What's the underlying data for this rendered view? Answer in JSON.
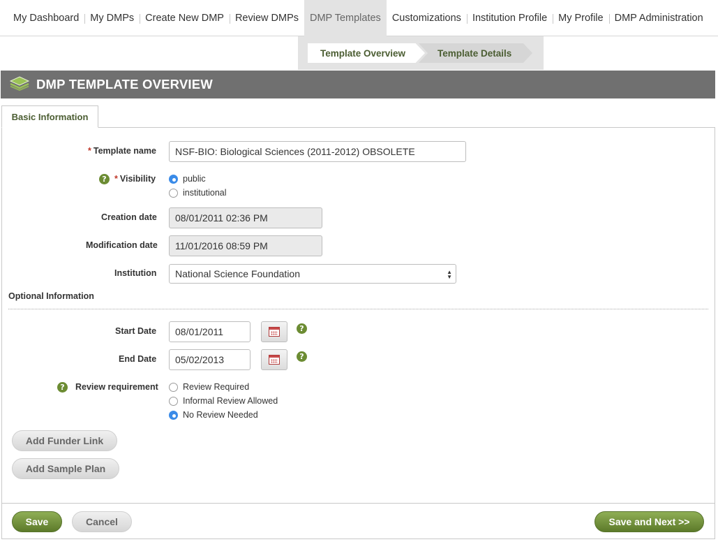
{
  "nav": {
    "items": [
      "My Dashboard",
      "My DMPs",
      "Create New DMP",
      "Review DMPs",
      "DMP Templates",
      "Customizations",
      "Institution Profile",
      "My Profile",
      "DMP Administration"
    ],
    "active": "DMP Templates"
  },
  "steps": [
    "Template Overview",
    "Template Details"
  ],
  "header": {
    "title": "DMP TEMPLATE OVERVIEW",
    "icon": "layers-icon"
  },
  "tab": "Basic Information",
  "form": {
    "template_name_label": "Template name",
    "template_name_value": "NSF-BIO: Biological Sciences (2011-2012) OBSOLETE",
    "visibility_label": "Visibility",
    "visibility_options": [
      "public",
      "institutional"
    ],
    "visibility_selected": "public",
    "creation_label": "Creation date",
    "creation_value": "08/01/2011 02:36 PM",
    "modification_label": "Modification date",
    "modification_value": "11/01/2016 08:59 PM",
    "institution_label": "Institution",
    "institution_value": "National Science Foundation",
    "required_mark": "*",
    "help_glyph": "?"
  },
  "optional": {
    "title": "Optional Information",
    "start_label": "Start Date",
    "start_value": "08/01/2011",
    "end_label": "End Date",
    "end_value": "05/02/2013",
    "review_label": "Review requirement",
    "review_options": [
      "Review Required",
      "Informal Review Allowed",
      "No Review Needed"
    ],
    "review_selected": "No Review Needed"
  },
  "buttons": {
    "add_funder": "Add Funder Link",
    "add_sample": "Add Sample Plan",
    "save": "Save",
    "cancel": "Cancel",
    "save_next": "Save and Next >>"
  },
  "colors": {
    "accent_green": "#5c7a2a",
    "header_grey": "#707070",
    "radio_blue": "#3a8be8"
  }
}
